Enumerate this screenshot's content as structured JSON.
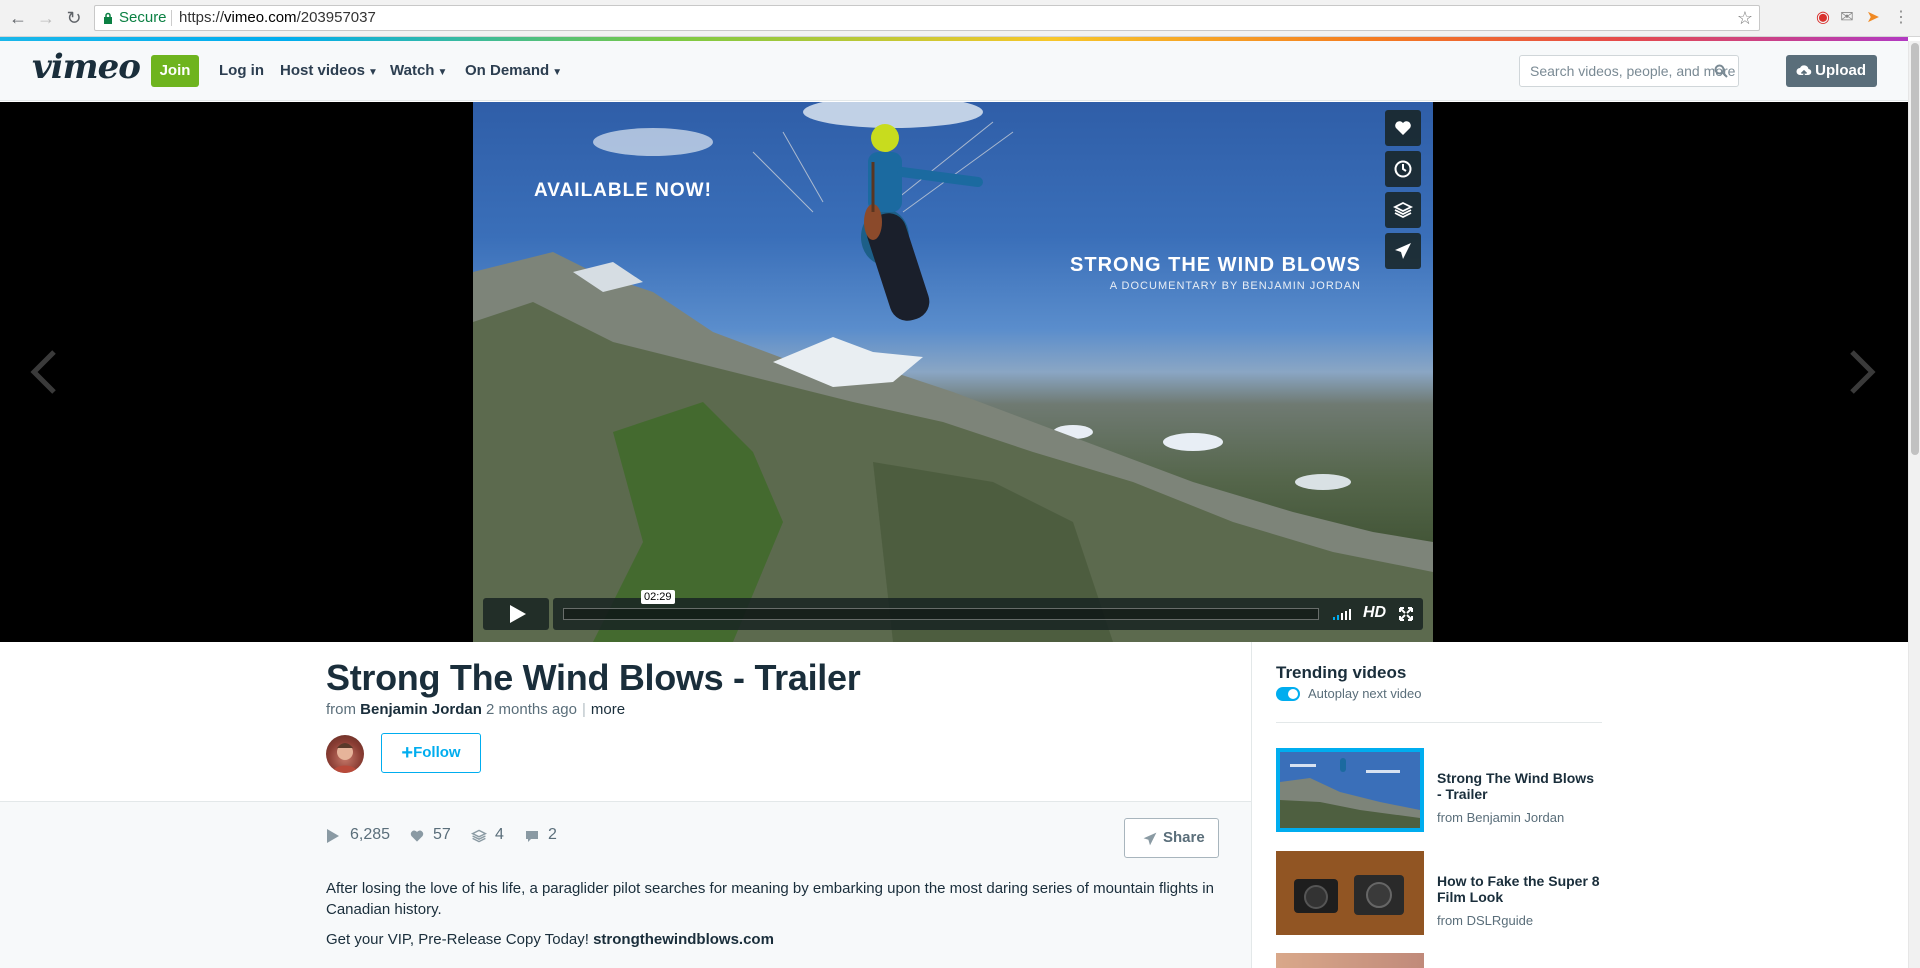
{
  "browser": {
    "secure_label": "Secure",
    "url_scheme": "https://",
    "url_host": "vimeo.com",
    "url_path": "/203957037"
  },
  "header": {
    "logo": "vimeo",
    "join": "Join",
    "login": "Log in",
    "host_videos": "Host videos",
    "watch": "Watch",
    "on_demand": "On Demand",
    "search_placeholder": "Search videos, people, and more",
    "upload": "Upload"
  },
  "player": {
    "overlay_available": "AVAILABLE NOW!",
    "overlay_title": "STRONG THE WIND BLOWS",
    "overlay_subtitle": "A DOCUMENTARY BY BENJAMIN JORDAN",
    "timecode": "02:29",
    "hd": "HD",
    "side_buttons": [
      "heart-icon",
      "clock-icon",
      "layers-icon",
      "send-icon"
    ]
  },
  "video": {
    "title": "Strong The Wind Blows - Trailer",
    "from": "from",
    "author": "Benjamin Jordan",
    "age": "2 months ago",
    "more": "more",
    "follow": "Follow",
    "stats": {
      "plays": "6,285",
      "likes": "57",
      "collections": "4",
      "comments": "2"
    },
    "share": "Share",
    "description": "After losing the love of his life, a paraglider pilot searches for meaning by embarking upon the most daring series of mountain flights in Canadian history.",
    "cta_text": "Get your VIP, Pre-Release Copy Today!",
    "cta_link": "strongthewindblows.com"
  },
  "sidebar": {
    "title": "Trending videos",
    "autoplay": "Autoplay next video",
    "autoplay_on": true,
    "items": [
      {
        "title": "Strong The Wind Blows - Trailer",
        "from": "from Benjamin Jordan"
      },
      {
        "title": "How to Fake the Super 8 Film Look",
        "from": "from DSLRguide"
      }
    ]
  },
  "colors": {
    "accent": "#00adef",
    "join_green": "#6eb41e",
    "text_dark": "#1a2e3b"
  }
}
